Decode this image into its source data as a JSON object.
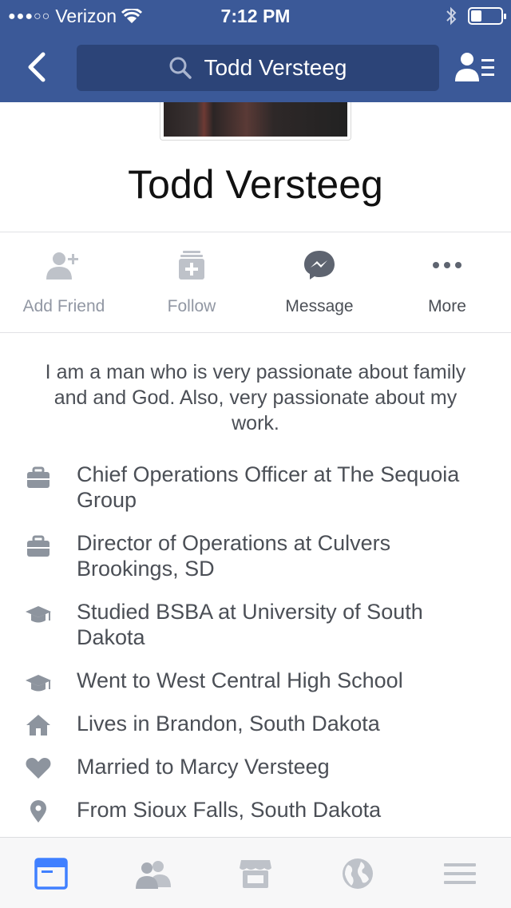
{
  "status_bar": {
    "signal": "●●●○○",
    "carrier": "Verizon",
    "time": "7:12 PM",
    "battery_level": 0.35
  },
  "nav": {
    "search_text": "Todd Versteeg"
  },
  "profile": {
    "name": "Todd Versteeg",
    "bio": "I am a man who is very passionate about family and and God. Also, very passionate about my work."
  },
  "actions": [
    {
      "label": "Add Friend",
      "icon": "add-friend-icon"
    },
    {
      "label": "Follow",
      "icon": "follow-icon"
    },
    {
      "label": "Message",
      "icon": "messenger-icon"
    },
    {
      "label": "More",
      "icon": "more-icon"
    }
  ],
  "intro": [
    {
      "icon": "briefcase-icon",
      "text": "Chief Operations Officer at The Sequoia Group"
    },
    {
      "icon": "briefcase-icon",
      "text": "Director of Operations at Culvers Brookings, SD"
    },
    {
      "icon": "graduation-cap-icon",
      "text": "Studied BSBA at University of South Dakota"
    },
    {
      "icon": "graduation-cap-icon",
      "text": "Went to West Central High School"
    },
    {
      "icon": "home-icon",
      "text": "Lives in Brandon, South Dakota"
    },
    {
      "icon": "heart-icon",
      "text": "Married to Marcy Versteeg"
    },
    {
      "icon": "location-pin-icon",
      "text": "From Sioux Falls, South Dakota"
    }
  ],
  "tab_bar": [
    "news-feed-icon",
    "friend-requests-icon",
    "marketplace-icon",
    "notifications-globe-icon",
    "menu-icon"
  ],
  "colors": {
    "brand": "#3b5998",
    "active_tab": "#4080ff",
    "icon_gray": "#8d949e",
    "text": "#4b4f56"
  }
}
